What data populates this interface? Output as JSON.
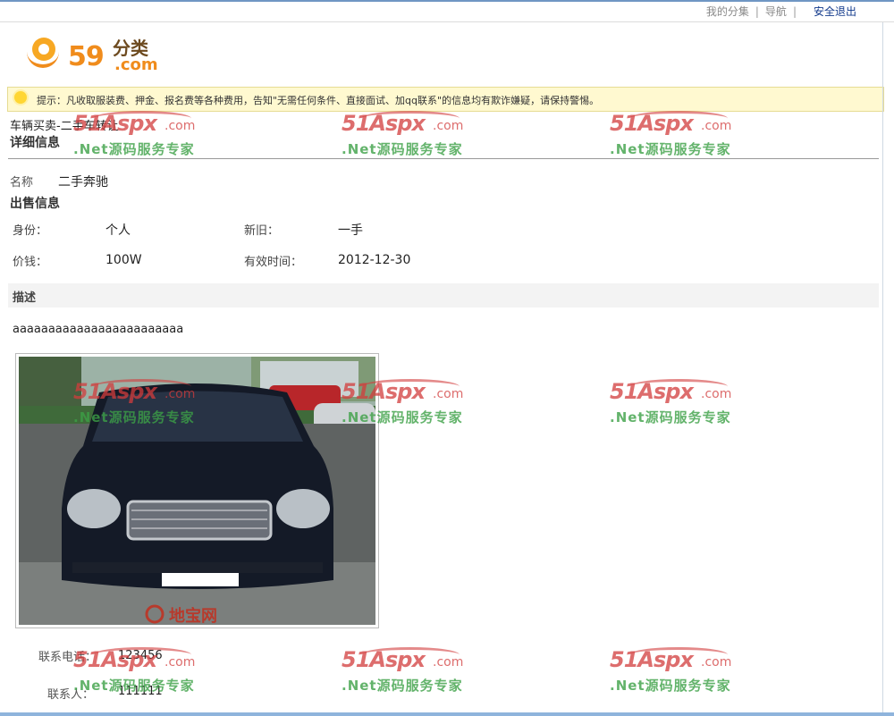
{
  "top_nav": {
    "my_listings": "我的分集",
    "separator": "|",
    "navigation": "导航",
    "logout": "安全退出"
  },
  "logo": {
    "number": "59",
    "category": "分类",
    "domain": ".com"
  },
  "tip": {
    "text": "提示：凡收取服装费、押金、报名费等各种费用，告知\"无需任何条件、直接面试、加qq联系\"的信息均有欺诈嫌疑，请保持警惕。"
  },
  "breadcrumb": "车辆买卖-二手车转让",
  "detail": {
    "section_title": "详细信息",
    "name_label": "名称",
    "name_value": "二手奔驰"
  },
  "sale": {
    "section_title": "出售信息",
    "identity_label": "身份：",
    "identity_value": "个人",
    "condition_label": "新旧：",
    "condition_value": "一手",
    "price_label": "价钱：",
    "price_value": "100W",
    "valid_label": "有效时间：",
    "valid_value": "2012-12-30"
  },
  "description": {
    "section_title": "描述",
    "text": "aaaaaaaaaaaaaaaaaaaaaaaa"
  },
  "photo": {
    "watermark": "地宝网"
  },
  "contact": {
    "phone_label": "联系电话：",
    "phone_value": "123456",
    "person_label": "联系人：",
    "person_value": "111111"
  },
  "watermark": {
    "brand": "51Aspx",
    "domain": ".com",
    "slogan": ".Net源码服务专家"
  },
  "colors": {
    "accent_link": "#123a8c",
    "logo_orange": "#f08c1c",
    "tip_background": "#fff9d0",
    "frame_blue": "#6f96c3"
  }
}
